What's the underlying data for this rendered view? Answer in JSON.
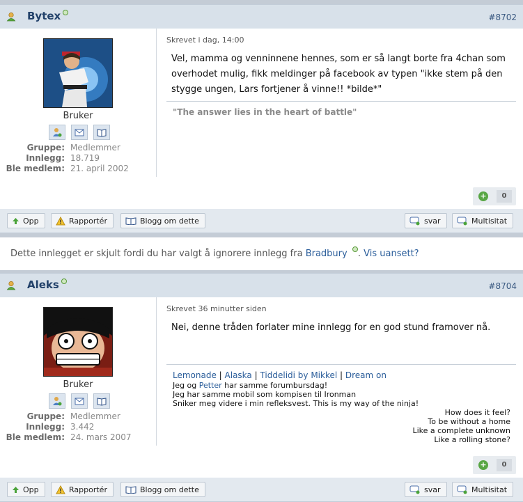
{
  "posts": [
    {
      "author": "Bytex",
      "post_number": "#8702",
      "rank": "Bruker",
      "stats": [
        {
          "key": "Gruppe:",
          "value": "Medlemmer"
        },
        {
          "key": "Innlegg:",
          "value": "18.719"
        },
        {
          "key": "Ble medlem:",
          "value": "21. april 2002"
        }
      ],
      "date": "Skrevet i dag, 14:00",
      "message": "Vel, mamma og venninnene hennes, som er så langt borte fra 4chan som overhodet mulig, fikk meldinger på facebook av typen \"ikke stem på den stygge ungen, Lars fortjener å vinne!! *bilde*\"",
      "signature": "\"The answer lies in the heart of battle\"",
      "reputation": "0"
    },
    {
      "author": "Aleks",
      "post_number": "#8704",
      "rank": "Bruker",
      "stats": [
        {
          "key": "Gruppe:",
          "value": "Medlemmer"
        },
        {
          "key": "Innlegg:",
          "value": "3.442"
        },
        {
          "key": "Ble medlem:",
          "value": "24. mars 2007"
        }
      ],
      "date": "Skrevet 36 minutter siden",
      "message": "Nei, denne tråden forlater mine innlegg for en god stund framover nå.",
      "signature_links": [
        "Lemonade",
        "Alaska",
        "Tiddelidi by Mikkel",
        "Dream on"
      ],
      "signature_separator": " | ",
      "signature_lines": [
        {
          "pre": "Jeg og ",
          "link": "Petter",
          "post": " har samme forumbursdag!"
        },
        {
          "pre": "Jeg har samme mobil som kompisen til Ironman",
          "link": "",
          "post": ""
        },
        {
          "pre": "Sniker meg videre i min refleksvest. This is my way of the ninja!",
          "link": "",
          "post": ""
        }
      ],
      "signature_right": [
        "How does it feel?",
        "To be without a home",
        "Like a complete unknown",
        "Like a rolling stone?"
      ],
      "reputation": "0"
    }
  ],
  "buttons": {
    "up": "Opp",
    "report": "Rapportér",
    "blog": "Blogg om dette",
    "reply": "svar",
    "multiquote": "Multisitat"
  },
  "ignored": {
    "text": "Dette innlegget er skjult fordi du har valgt å ignorere innlegg fra ",
    "user": "Bradbury",
    "link": "Vis uansett?",
    "dot": ". "
  }
}
